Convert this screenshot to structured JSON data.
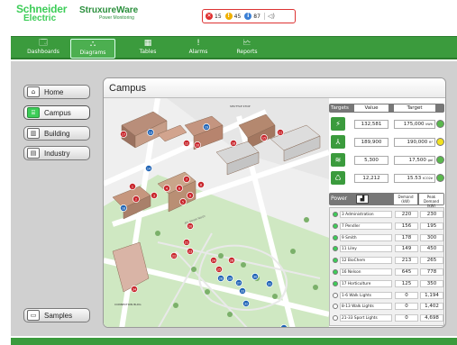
{
  "document_id": "EB100281",
  "brand": {
    "company_line1": "Schneider",
    "company_line2": "Electric",
    "product_line1": "StruxureWare",
    "product_line2": "Power Monitoring"
  },
  "alarms": [
    {
      "icon": "critical-alarm-icon",
      "color": "#e03030",
      "count": "15"
    },
    {
      "icon": "warning-alarm-icon",
      "color": "#f0b000",
      "count": "45"
    },
    {
      "icon": "info-alarm-icon",
      "color": "#3a7fd5",
      "count": "87"
    }
  ],
  "sound_icon": "speaker-icon",
  "nav": [
    {
      "label": "Dashboards",
      "icon": "dashboard-icon",
      "glyph": "🗔"
    },
    {
      "label": "Diagrams",
      "icon": "diagram-icon",
      "glyph": "⛬",
      "active": true
    },
    {
      "label": "Tables",
      "icon": "table-icon",
      "glyph": "▦"
    },
    {
      "label": "Alarms",
      "icon": "alarm-icon",
      "glyph": "!"
    },
    {
      "label": "Reports",
      "icon": "report-icon",
      "glyph": "🗠"
    }
  ],
  "side_nav": [
    {
      "label": "Home",
      "icon": "home-icon",
      "glyph": "⌂"
    },
    {
      "label": "Campus",
      "icon": "campus-icon",
      "glyph": "⌸",
      "active": true
    },
    {
      "label": "Building",
      "icon": "building-icon",
      "glyph": "▥"
    },
    {
      "label": "Industry",
      "icon": "industry-icon",
      "glyph": "▤"
    },
    {
      "label": "Samples",
      "icon": "samples-icon",
      "glyph": "▭"
    }
  ],
  "main": {
    "title": "Campus"
  },
  "targets": {
    "header": {
      "label": "Targets",
      "value": "Value",
      "target": "Target"
    },
    "rows": [
      {
        "icon": "energy-icon",
        "glyph": "⚡",
        "value": "132,581",
        "target": "175,000",
        "unit": "kWh",
        "status": "#59b84c"
      },
      {
        "icon": "area-icon",
        "glyph": "⅄",
        "value": "189,900",
        "target": "190,000",
        "unit": "ft²",
        "status": "#f2e11f"
      },
      {
        "icon": "cooling-icon",
        "glyph": "≋",
        "value": "5,300",
        "target": "17,500",
        "unit": "gal",
        "status": "#59b84c"
      },
      {
        "icon": "carbon-icon",
        "glyph": "♺",
        "value": "12,212",
        "target": "15.53",
        "unit": "tCO2e",
        "status": "#59b84c"
      }
    ]
  },
  "power": {
    "header": {
      "label": "Power",
      "icon": "power-icon",
      "glyph": "▟",
      "demand": "Demand (kW)",
      "peak": "Peak Demand (kW)"
    },
    "rows": [
      {
        "name": "3 Administration",
        "demand": "220",
        "peak": "230",
        "on": true
      },
      {
        "name": "7 Pendler",
        "demand": "156",
        "peak": "195",
        "on": true
      },
      {
        "name": "9 Smith",
        "demand": "178",
        "peak": "300",
        "on": true
      },
      {
        "name": "11 Liley",
        "demand": "149",
        "peak": "450",
        "on": true
      },
      {
        "name": "12 BioChem",
        "demand": "213",
        "peak": "265",
        "on": true
      },
      {
        "name": "16 Nelson",
        "demand": "645",
        "peak": "778",
        "on": true
      },
      {
        "name": "17 Horticulture",
        "demand": "125",
        "peak": "350",
        "on": true
      },
      {
        "name": "1-6 Walk Lights",
        "demand": "0",
        "peak": "1,194",
        "on": false
      },
      {
        "name": "8-13 Walk Lights",
        "demand": "0",
        "peak": "1,402",
        "on": false
      },
      {
        "name": "21-33 Sport Lights",
        "demand": "0",
        "peak": "4,698",
        "on": false
      }
    ]
  },
  "map_labels": {
    "shuttle": "SHUTTLE STOP",
    "building": "CONNECTION BLDG",
    "street": "4th Street North"
  },
  "markers": [
    {
      "num": "1",
      "kind": "red"
    },
    {
      "num": "2",
      "kind": "red"
    },
    {
      "num": "3",
      "kind": "red"
    },
    {
      "num": "4",
      "kind": "red"
    },
    {
      "num": "5",
      "kind": "red"
    },
    {
      "num": "6",
      "kind": "red"
    },
    {
      "num": "7",
      "kind": "red"
    },
    {
      "num": "8",
      "kind": "red"
    },
    {
      "num": "9",
      "kind": "red"
    },
    {
      "num": "10",
      "kind": "red"
    },
    {
      "num": "11",
      "kind": "red"
    },
    {
      "num": "12",
      "kind": "red"
    },
    {
      "num": "13",
      "kind": "blue"
    },
    {
      "num": "14",
      "kind": "blue"
    },
    {
      "num": "15",
      "kind": "red"
    },
    {
      "num": "16",
      "kind": "red"
    },
    {
      "num": "17",
      "kind": "red"
    },
    {
      "num": "18",
      "kind": "blue"
    },
    {
      "num": "19",
      "kind": "blue"
    },
    {
      "num": "20",
      "kind": "red"
    },
    {
      "num": "21",
      "kind": "red"
    },
    {
      "num": "22",
      "kind": "red"
    },
    {
      "num": "23",
      "kind": "red"
    },
    {
      "num": "24",
      "kind": "red"
    },
    {
      "num": "25",
      "kind": "red"
    },
    {
      "num": "26",
      "kind": "red"
    },
    {
      "num": "27",
      "kind": "blue"
    },
    {
      "num": "28",
      "kind": "blue"
    },
    {
      "num": "29",
      "kind": "blue"
    },
    {
      "num": "30",
      "kind": "blue"
    },
    {
      "num": "31",
      "kind": "blue"
    },
    {
      "num": "32",
      "kind": "blue"
    },
    {
      "num": "33",
      "kind": "blue"
    },
    {
      "num": "34",
      "kind": "red"
    },
    {
      "num": "35",
      "kind": "blue"
    }
  ]
}
